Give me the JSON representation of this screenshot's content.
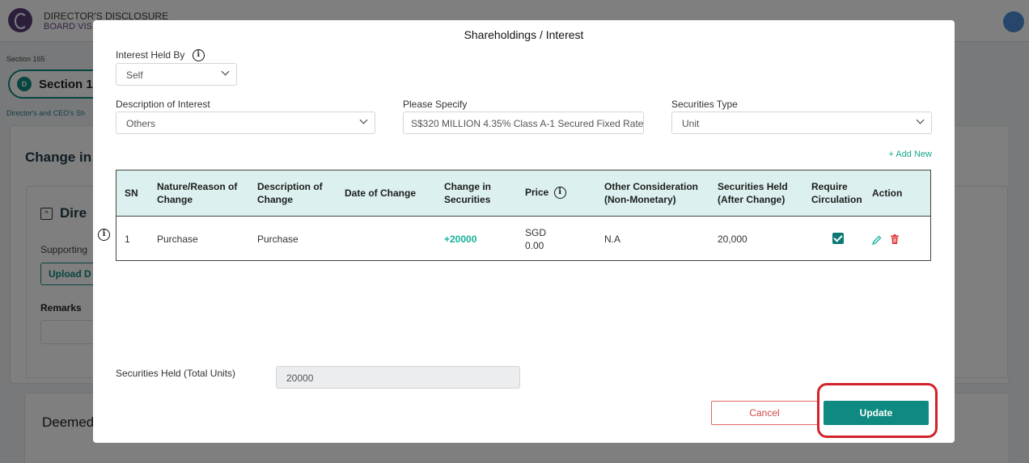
{
  "background": {
    "app_title": "DIRECTOR'S DISCLOSURE",
    "app_subtitle": "BOARD VIS",
    "breadcrumb": "Section 165",
    "section_badge_letter": "D",
    "section_pill_label": "Section 1",
    "section_description": "Director's and CEO's Sh",
    "change_heading": "Change in",
    "directors_heading": "Dire",
    "supporting_label": "Supporting",
    "upload_button": "Upload D",
    "remarks_label": "Remarks",
    "deemed_heading": "Deemed"
  },
  "modal": {
    "title": "Shareholdings / Interest",
    "interest_held_by": {
      "label": "Interest Held By",
      "value": "Self"
    },
    "description_of_interest": {
      "label": "Description of Interest",
      "value": "Others"
    },
    "please_specify": {
      "label": "Please Specify",
      "value": "S$320 MILLION 4.35% Class A-1 Secured Fixed Rate"
    },
    "securities_type": {
      "label": "Securities Type",
      "value": "Unit"
    },
    "add_new": "+ Add New",
    "table": {
      "headers": {
        "sn": "SN",
        "nature_line1": "Nature/Reason of",
        "nature_line2": "Change",
        "description_line1": "Description of",
        "description_line2": "Change",
        "date": "Date of Change",
        "change_line1": "Change in",
        "change_line2": "Securities",
        "price": "Price",
        "other_line1": "Other Consideration",
        "other_line2": "(Non-Monetary)",
        "held_line1": "Securities Held",
        "held_line2": "(After Change)",
        "require_line1": "Require",
        "require_line2": "Circulation",
        "action": "Action"
      },
      "rows": [
        {
          "sn": "1",
          "nature": "Purchase",
          "description": "Purchase",
          "date": "",
          "change": "+20000",
          "price_currency": "SGD",
          "price_value": "0.00",
          "other": "N.A",
          "held": "20,000",
          "require_circulation": true
        }
      ]
    },
    "total_units": {
      "label": "Securities Held (Total Units)",
      "value": "20000"
    },
    "cancel_button": "Cancel",
    "update_button": "Update"
  },
  "icons": {
    "info": "info-circle-icon",
    "chevron": "chevron-down-icon",
    "edit": "pencil-icon",
    "delete": "trash-icon",
    "checkbox": "checkbox-checked-icon"
  },
  "colors": {
    "accent": "#0e8a80",
    "add_new": "#1aa58f",
    "change_positive": "#15b29a",
    "table_header_bg": "#dcf1ef",
    "cancel": "#d04848",
    "highlight": "#d2232a",
    "delete": "#e0393e"
  }
}
